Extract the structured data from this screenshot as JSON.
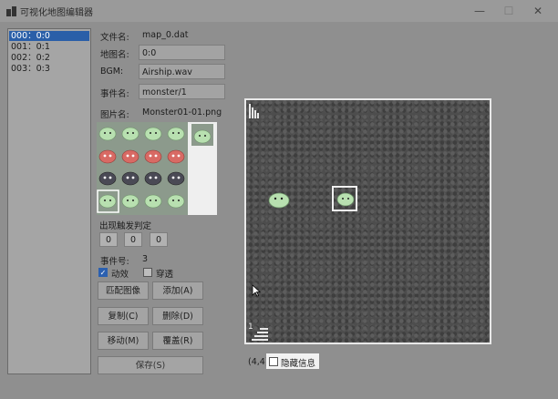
{
  "window": {
    "title": "可视化地图编辑器",
    "controls": [
      "—",
      "☐",
      "✕"
    ]
  },
  "map_list": {
    "items": [
      "000：0:0",
      "001：0:1",
      "002：0:2",
      "003：0:3"
    ],
    "selected_index": 0
  },
  "fields": {
    "file_label": "文件名:",
    "file_value": "map_0.dat",
    "map_label": "地图名:",
    "map_value": "0:0",
    "bgm_label": "BGM:",
    "bgm_value": "Airship.wav",
    "event_label": "事件名:",
    "event_value": "monster/1",
    "image_label": "图片名:",
    "image_value": "Monster01-01.png"
  },
  "trigger": {
    "label": "出现触发判定",
    "values": [
      "0",
      "0",
      "0"
    ]
  },
  "event_no": {
    "label": "事件号:",
    "value": "3"
  },
  "checks": {
    "anim_label": "动效",
    "anim_checked": true,
    "pass_label": "穿透",
    "pass_checked": false
  },
  "buttons": {
    "match": "匹配图像",
    "add": "添加(A)",
    "copy": "复制(C)",
    "delete": "删除(D)",
    "move": "移动(M)",
    "overwrite": "覆盖(R)",
    "save": "保存(S)"
  },
  "status": {
    "coords": "(4,4)",
    "hide_info_label": "隐藏信息",
    "hide_info_checked": false
  },
  "map": {
    "floor_number": "1"
  },
  "colors": {
    "selection": "#2a5fa8",
    "slime_green": "#b8e0b0",
    "slime_red": "#d86a64",
    "slime_dark": "#4a4a55"
  }
}
